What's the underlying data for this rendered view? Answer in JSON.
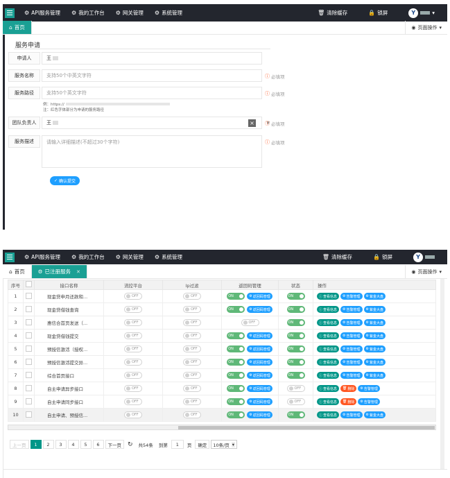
{
  "nav": {
    "items": [
      "API服务管理",
      "我的工作台",
      "网关管理",
      "系统管理"
    ],
    "clear_cache": "清除缓存",
    "lock": "锁屏",
    "user": "admin"
  },
  "form_page": {
    "home_tab": "首页",
    "page_ops": "页面操作",
    "title": "服务申请",
    "applicant_label": "申请人",
    "applicant_value": "王",
    "service_name_label": "服务名称",
    "service_name_placeholder": "支持50个中英文字符",
    "service_path_label": "服务路径",
    "service_path_placeholder": "支持50个英文字符",
    "required": "必填项",
    "hint1": "例：https://",
    "hint2": "注：红色字体部分为申请的服务路径",
    "team_lead_label": "团队负责人",
    "team_lead_value": "王",
    "desc_label": "服务描述",
    "desc_placeholder": "请输入详细描述(不超过30个字符)",
    "submit": "确认提交"
  },
  "list_page": {
    "home_tab": "首页",
    "active_tab": "已注册服务",
    "page_ops": "页面操作",
    "columns": [
      "序号",
      "",
      "接口名称",
      "流控平台",
      "Ip过滤",
      "返回码管理",
      "状态",
      "操作"
    ],
    "on": "ON",
    "off": "OFF",
    "btn_return": "返回码管理",
    "btn_view": "查看信息",
    "btn_alert": "告警管理",
    "btn_big": "紫金大盘",
    "btn_delete": "删除",
    "rows": [
      {
        "no": "1",
        "name": "现金贷申月还款和...",
        "ret": "on",
        "status": "on",
        "del": false
      },
      {
        "no": "2",
        "name": "现金贷借钱查询",
        "ret": "on",
        "status": "on",
        "del": false
      },
      {
        "no": "3",
        "name": "惠信合首页发送（...",
        "ret": "off",
        "status": "on",
        "del": false
      },
      {
        "no": "4",
        "name": "现金贷借钱提交",
        "ret": "on",
        "status": "on",
        "del": false
      },
      {
        "no": "5",
        "name": "预授信激活（授权...",
        "ret": "on",
        "status": "on",
        "del": false
      },
      {
        "no": "6",
        "name": "预授信激活提交异...",
        "ret": "on",
        "status": "on",
        "del": false
      },
      {
        "no": "7",
        "name": "综合首页接口",
        "ret": "on",
        "status": "on",
        "del": false
      },
      {
        "no": "8",
        "name": "自主申请异步接口",
        "ret": "on",
        "status": "off",
        "del": true
      },
      {
        "no": "9",
        "name": "自主申请同步接口",
        "ret": "on",
        "status": "off",
        "del": true
      },
      {
        "no": "10",
        "name": "自主申请、预授信...",
        "ret": "on",
        "status": "on",
        "del": false
      }
    ],
    "pager": {
      "prev": "上一页",
      "pages": [
        "1",
        "2",
        "3",
        "4",
        "5",
        "6"
      ],
      "next": "下一页",
      "total": "共54条",
      "goto": "到第",
      "page_value": "1",
      "page_unit": "页",
      "confirm": "确定",
      "page_size": "10条/页"
    }
  }
}
